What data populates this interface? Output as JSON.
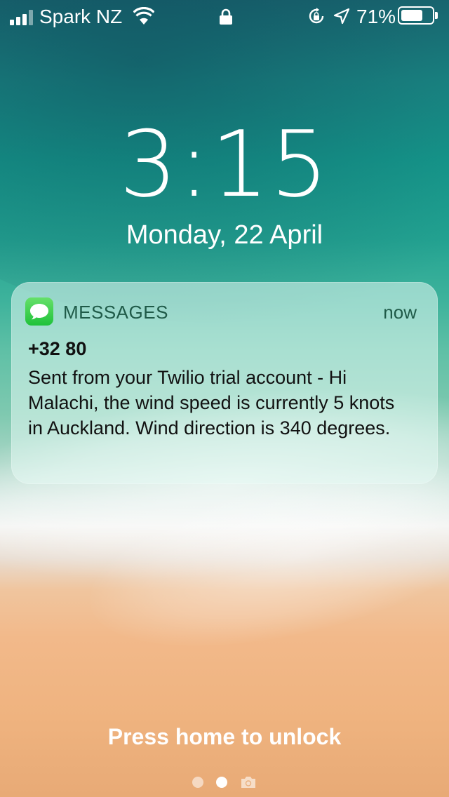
{
  "status_bar": {
    "carrier": "Spark NZ",
    "battery_percent": "71%",
    "battery_level": 0.71,
    "signal_bars_filled": 3,
    "signal_bars_total": 4,
    "icons": [
      "signal-icon",
      "wifi-icon",
      "lock-icon",
      "rotation-lock-icon",
      "location-arrow-icon",
      "battery-icon"
    ]
  },
  "lock_screen": {
    "time": "3:15",
    "date": "Monday, 22 April",
    "unlock_hint": "Press home to unlock"
  },
  "notification": {
    "app_name": "MESSAGES",
    "app_icon": "messages-icon",
    "time": "now",
    "sender": "+32 80",
    "body": "Sent from your Twilio trial account - Hi Malachi, the wind speed is currently 5 knots in Auckland. Wind direction is 340 degrees."
  },
  "page_indicator": {
    "pages": 3,
    "active_index": 1,
    "last_icon": "camera-icon"
  },
  "colors": {
    "messages_green": "#29c94a",
    "text_white": "#ffffff"
  }
}
